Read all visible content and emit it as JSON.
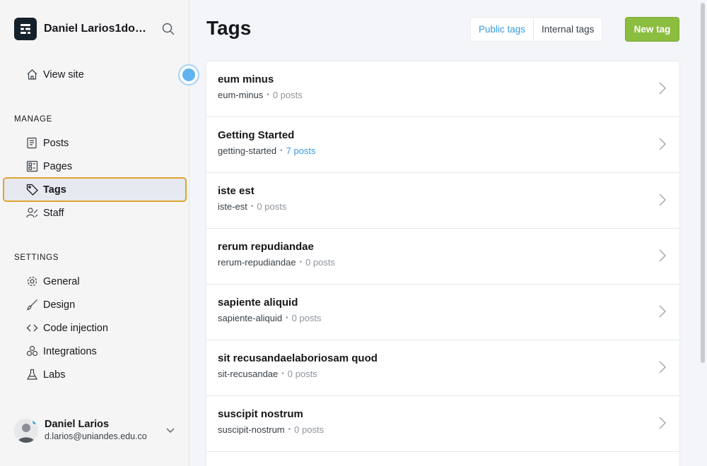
{
  "sidebar": {
    "site_name": "Daniel Larios1dol...",
    "logo_icon": "ghost-logo-icon",
    "search_icon": "search-icon",
    "view_site": {
      "label": "View site",
      "icon": "home-icon"
    },
    "manage_label": "MANAGE",
    "manage_items": [
      {
        "label": "Posts",
        "icon": "posts-icon"
      },
      {
        "label": "Pages",
        "icon": "pages-icon"
      },
      {
        "label": "Tags",
        "icon": "tag-icon",
        "active": true
      },
      {
        "label": "Staff",
        "icon": "staff-icon"
      }
    ],
    "settings_label": "SETTINGS",
    "settings_items": [
      {
        "label": "General",
        "icon": "gear-icon"
      },
      {
        "label": "Design",
        "icon": "brush-icon"
      },
      {
        "label": "Code injection",
        "icon": "code-icon"
      },
      {
        "label": "Integrations",
        "icon": "integrations-icon"
      },
      {
        "label": "Labs",
        "icon": "flask-icon"
      }
    ],
    "user": {
      "name": "Daniel Larios",
      "email": "d.larios@uniandes.edu.co"
    }
  },
  "header": {
    "title": "Tags",
    "public_tab": "Public tags",
    "internal_tab": "Internal tags",
    "new_button": "New tag"
  },
  "colors": {
    "accent_blue": "#3b9ae0",
    "new_button_green": "#8bbd3f",
    "active_outline": "#e0a431"
  },
  "tags": [
    {
      "name": "eum minus",
      "slug": "eum-minus",
      "count": "0 posts"
    },
    {
      "name": "Getting Started",
      "slug": "getting-started",
      "count": "7 posts"
    },
    {
      "name": "iste est",
      "slug": "iste-est",
      "count": "0 posts"
    },
    {
      "name": "rerum repudiandae",
      "slug": "rerum-repudiandae",
      "count": "0 posts"
    },
    {
      "name": "sapiente aliquid",
      "slug": "sapiente-aliquid",
      "count": "0 posts"
    },
    {
      "name": "sit recusandaelaboriosam quod",
      "slug": "sit-recusandae",
      "count": "0 posts"
    },
    {
      "name": "suscipit nostrum",
      "slug": "suscipit-nostrum",
      "count": "0 posts"
    }
  ]
}
